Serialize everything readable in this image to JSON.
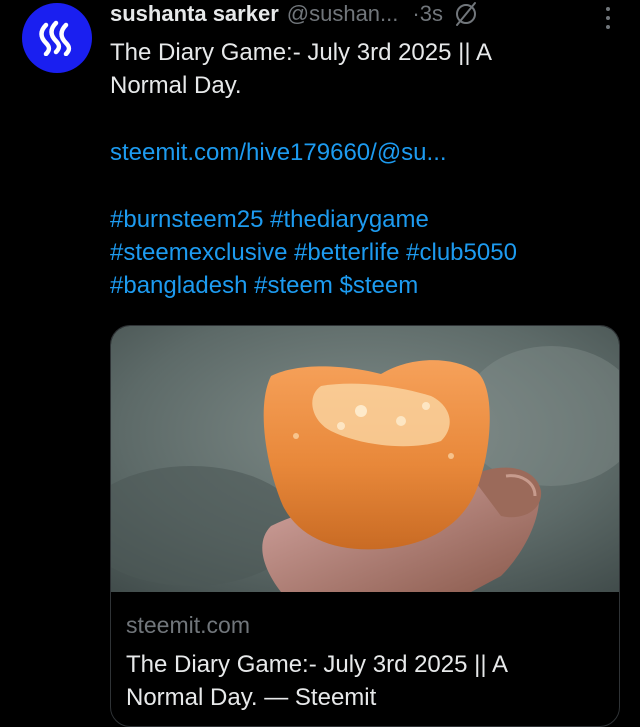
{
  "tweet": {
    "author_name": "sushanta sarker",
    "handle": "@sushan...",
    "time": "·3s",
    "avatar_icon": "steem-logo-icon",
    "grok_icon": "grok-icon",
    "more_icon": "more-vertical-icon",
    "text_line1": "The Diary Game:- July 3rd  2025 || A",
    "text_line2": "Normal Day.",
    "link": "steemit.com/hive179660/@su...",
    "hashtags_line1": "#burnsteem25 #thediarygame",
    "hashtags_line2": "#steemexclusive #betterlife #club5050",
    "hashtags_line3": "#bangladesh #steem $steem"
  },
  "card": {
    "domain": "steemit.com",
    "title_line1": "The Diary Game:- July 3rd 2025 || A",
    "title_line2": "Normal Day. — Steemit"
  },
  "colors": {
    "background": "#000000",
    "accent": "#1d9bf0",
    "avatar_bg": "#1a1ff0",
    "muted": "#71767b"
  }
}
